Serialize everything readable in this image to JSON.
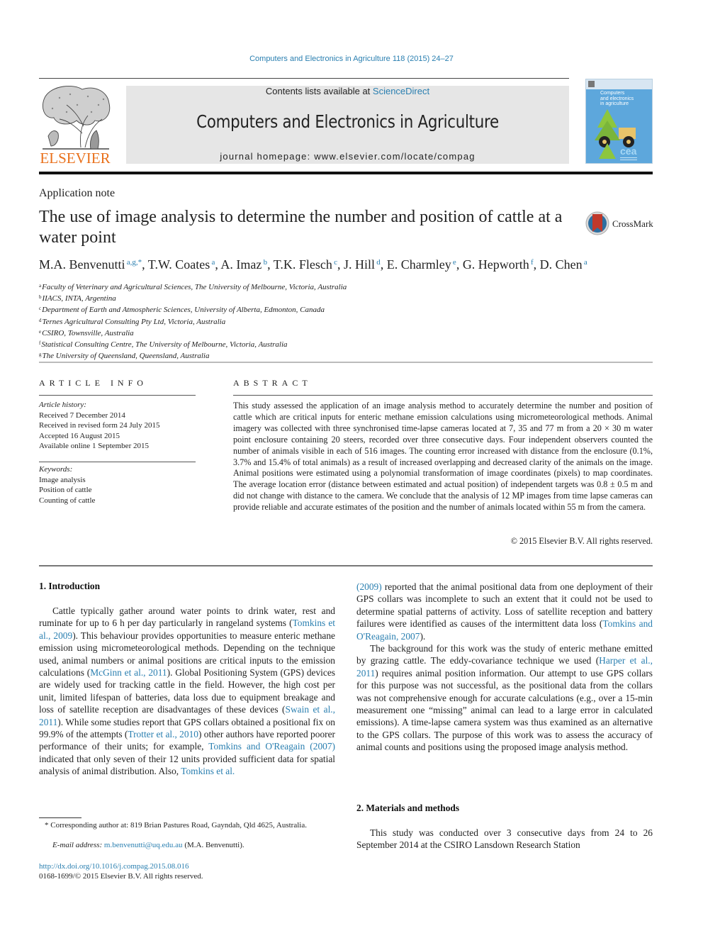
{
  "header": {
    "citation": "Computers and Electronics in Agriculture 118 (2015) 24–27",
    "publisher_logo_text": "ELSEVIER",
    "contents_prefix": "Contents lists available at ",
    "contents_link": "ScienceDirect",
    "journal_name": "Computers and Electronics in Agriculture",
    "homepage": "journal homepage: www.elsevier.com/locate/compag",
    "cover_title_lines": [
      "Computers",
      "and electronics",
      "in agriculture"
    ],
    "cover_badge": "cea"
  },
  "colors": {
    "link": "#2a7fb0",
    "elsevier_orange": "#e9711c",
    "banner_gray": "#e6e6e6",
    "cover_blue": "#5da7dc"
  },
  "article": {
    "type": "Application note",
    "title": "The use of image analysis to determine the number and position of cattle at a water point",
    "crossmark_label": "CrossMark",
    "authors": [
      {
        "name": "M.A. Benvenutti",
        "sup": "a,g,*"
      },
      {
        "name": "T.W. Coates",
        "sup": "a"
      },
      {
        "name": "A. Imaz",
        "sup": "b"
      },
      {
        "name": "T.K. Flesch",
        "sup": "c"
      },
      {
        "name": "J. Hill",
        "sup": "d"
      },
      {
        "name": "E. Charmley",
        "sup": "e"
      },
      {
        "name": "G. Hepworth",
        "sup": "f"
      },
      {
        "name": "D. Chen",
        "sup": "a"
      }
    ],
    "affiliations": [
      {
        "key": "a",
        "text": "Faculty of Veterinary and Agricultural Sciences, The University of Melbourne, Victoria, Australia"
      },
      {
        "key": "b",
        "text": "IIACS, INTA, Argentina"
      },
      {
        "key": "c",
        "text": "Department of Earth and Atmospheric Sciences, University of Alberta, Edmonton, Canada"
      },
      {
        "key": "d",
        "text": "Ternes Agricultural Consulting Pty Ltd, Victoria, Australia"
      },
      {
        "key": "e",
        "text": "CSIRO, Townsville, Australia"
      },
      {
        "key": "f",
        "text": "Statistical Consulting Centre, The University of Melbourne, Victoria, Australia"
      },
      {
        "key": "g",
        "text": "The University of Queensland, Queensland, Australia"
      }
    ]
  },
  "article_info": {
    "heading": "ARTICLE INFO",
    "history_label": "Article history:",
    "history": [
      "Received 7 December 2014",
      "Received in revised form 24 July 2015",
      "Accepted 16 August 2015",
      "Available online 1 September 2015"
    ],
    "keywords_label": "Keywords:",
    "keywords": [
      "Image analysis",
      "Position of cattle",
      "Counting of cattle"
    ]
  },
  "abstract": {
    "heading": "ABSTRACT",
    "text": "This study assessed the application of an image analysis method to accurately determine the number and position of cattle which are critical inputs for enteric methane emission calculations using micrometeo­rological methods. Animal imagery was collected with three synchronised time-lapse cameras located at 7, 35 and 77 m from a 20 × 30 m water point enclosure containing 20 steers, recorded over three consec­utive days. Four independent observers counted the number of animals visible in each of 516 images. The counting error increased with distance from the enclosure (0.1%, 3.7% and 15.4% of total animals) as a result of increased overlapping and decreased clarity of the animals on the image. Animal positions were estimated using a polynomial transformation of image coordinates (pixels) to map coordinates. The aver­age location error (distance between estimated and actual position) of independent targets was 0.8 ± 0.5 m and did not change with distance to the camera. We conclude that the analysis of 12 MP images from time lapse cameras can provide reliable and accurate estimates of the position and the num­ber of animals located within 55 m from the camera.",
    "copyright": "© 2015 Elsevier B.V. All rights reserved."
  },
  "sections": {
    "intro_heading": "1. Introduction",
    "intro_p1": [
      {
        "t": "Cattle typically gather around water points to drink water, rest and ruminate for up to 6 h per day particularly in rangeland sys­tems ("
      },
      {
        "t": "Tomkins et al., 2009",
        "link": true
      },
      {
        "t": "). This behaviour provides opportunities to measure enteric methane emission using micrometeorological methods. Depending on the technique used, animal numbers or animal positions are critical inputs to the emission calculations ("
      },
      {
        "t": "McGinn et al., 2011",
        "link": true
      },
      {
        "t": "). Global Positioning System (GPS) devices are widely used for tracking cattle in the field. However, the high cost per unit, limited lifespan of batteries, data loss due to equip­ment breakage and loss of satellite reception are disadvantages of these devices ("
      },
      {
        "t": "Swain et al., 2011",
        "link": true
      },
      {
        "t": "). While some studies report that GPS collars obtained a positional fix on 99.9% of the attempts ("
      },
      {
        "t": "Trotter et al., 2010",
        "link": true
      },
      {
        "t": ") other authors have reported poorer perfor­mance of their units; for example, "
      },
      {
        "t": "Tomkins and O'Reagain (2007)",
        "link": true
      },
      {
        "t": " indicated that only seven of their 12 units provided sufficient data for spatial analysis of animal distribution. Also, "
      },
      {
        "t": "Tomkins et al.",
        "link": true
      }
    ],
    "intro_p1_cont": [
      {
        "t": "(2009)",
        "link": true
      },
      {
        "t": " reported that the animal positional data from one deploy­ment of their GPS collars was incomplete to such an extent that it could not be used to determine spatial patterns of activity. Loss of satellite reception and battery failures were identified as causes of the intermittent data loss ("
      },
      {
        "t": "Tomkins and O'Reagain, 2007",
        "link": true
      },
      {
        "t": ")."
      }
    ],
    "intro_p2": [
      {
        "t": "The background for this work was the study of enteric methane emitted by grazing cattle. The eddy-covariance technique we used ("
      },
      {
        "t": "Harper et al., 2011",
        "link": true
      },
      {
        "t": ") requires animal position information. Our attempt to use GPS collars for this purpose was not successful, as the positional data from the collars was not comprehensive enough for accurate calculations (e.g., over a 15-min measurement one “missing” animal can lead to a large error in calculated emissions). A time-lapse camera system was thus examined as an alternative to the GPS collars. The purpose of this work was to assess the accu­racy of animal counts and positions using the proposed image analysis method."
      }
    ],
    "methods_heading": "2. Materials and methods",
    "methods_p1": "This study was conducted over 3 consecutive days from 24 to 26 September 2014 at the CSIRO Lansdown Research Station"
  },
  "footnotes": {
    "corresponding": "* Corresponding author at: 819 Brian Pastures Road, Gayndah, Qld 4625, Australia.",
    "email_label": "E-mail address: ",
    "email": "m.benvenutti@uq.edu.au",
    "email_suffix": " (M.A. Benvenutti).",
    "doi": "http://dx.doi.org/10.1016/j.compag.2015.08.016",
    "issn": "0168-1699/© 2015 Elsevier B.V. All rights reserved."
  }
}
